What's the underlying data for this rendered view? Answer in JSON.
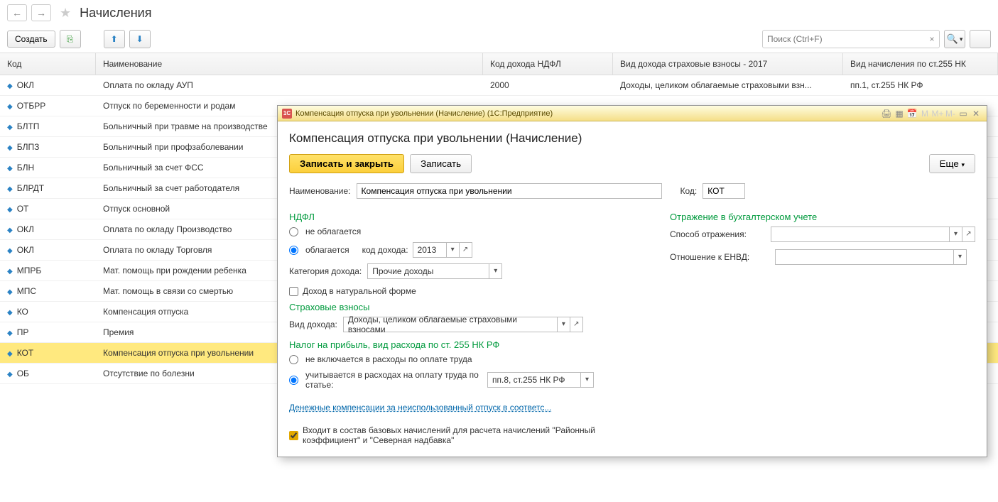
{
  "page": {
    "title": "Начисления",
    "create_btn": "Создать",
    "search_placeholder": "Поиск (Ctrl+F)"
  },
  "table": {
    "headers": {
      "code": "Код",
      "name": "Наименование",
      "ndfl": "Код дохода НДФЛ",
      "ins": "Вид дохода страховые взносы - 2017",
      "c255": "Вид начисления по ст.255 НК"
    },
    "rows": [
      {
        "code": "ОКЛ",
        "name": "Оплата по окладу АУП",
        "ndfl": "2000",
        "ins": "Доходы, целиком облагаемые страховыми взн...",
        "c255": "пп.1, ст.255 НК РФ"
      },
      {
        "code": "ОТБРР",
        "name": "Отпуск по беременности и родам",
        "ndfl": "",
        "ins": "",
        "c255": ""
      },
      {
        "code": "БЛТП",
        "name": "Больничный при травме на производстве",
        "ndfl": "",
        "ins": "",
        "c255": ""
      },
      {
        "code": "БЛПЗ",
        "name": "Больничный при профзаболевании",
        "ndfl": "",
        "ins": "",
        "c255": ""
      },
      {
        "code": "БЛН",
        "name": "Больничный за счет ФСС",
        "ndfl": "",
        "ins": "",
        "c255": ""
      },
      {
        "code": "БЛРДТ",
        "name": "Больничный за счет работодателя",
        "ndfl": "",
        "ins": "",
        "c255": ""
      },
      {
        "code": "ОТ",
        "name": "Отпуск основной",
        "ndfl": "",
        "ins": "",
        "c255": ""
      },
      {
        "code": "ОКЛ",
        "name": "Оплата по окладу Производство",
        "ndfl": "",
        "ins": "",
        "c255": ""
      },
      {
        "code": "ОКЛ",
        "name": "Оплата по окладу Торговля",
        "ndfl": "",
        "ins": "",
        "c255": ""
      },
      {
        "code": "МПРБ",
        "name": "Мат. помощь при рождении ребенка",
        "ndfl": "",
        "ins": "",
        "c255": ""
      },
      {
        "code": "МПС",
        "name": "Мат. помощь в связи со смертью",
        "ndfl": "",
        "ins": "",
        "c255": ""
      },
      {
        "code": "КО",
        "name": "Компенсация отпуска",
        "ndfl": "",
        "ins": "",
        "c255": ""
      },
      {
        "code": "ПР",
        "name": "Премия",
        "ndfl": "",
        "ins": "",
        "c255": ""
      },
      {
        "code": "КОТ",
        "name": "Компенсация отпуска при увольнении",
        "ndfl": "",
        "ins": "",
        "c255": "",
        "selected": true
      },
      {
        "code": "ОБ",
        "name": "Отсутствие по болезни",
        "ndfl": "",
        "ins": "",
        "c255": ""
      }
    ]
  },
  "modal": {
    "window_title": "Компенсация отпуска при увольнении (Начисление)  (1С:Предприятие)",
    "header": "Компенсация отпуска при увольнении (Начисление)",
    "save_close": "Записать и закрыть",
    "save": "Записать",
    "more": "Еще",
    "name_label": "Наименование:",
    "name_value": "Компенсация отпуска при увольнении",
    "code_label": "Код:",
    "code_value": "КОТ",
    "ndfl_title": "НДФЛ",
    "ndfl_opt1": "не облагается",
    "ndfl_opt2": "облагается",
    "ndfl_code_income_label": "код дохода:",
    "ndfl_code_income_value": "2013",
    "cat_income_label": "Категория дохода:",
    "cat_income_value": "Прочие доходы",
    "natural_form": "Доход в натуральной форме",
    "ins_title": "Страховые взносы",
    "ins_type_label": "Вид дохода:",
    "ins_type_value": "Доходы, целиком облагаемые страховыми взносами",
    "profit_title": "Налог на прибыль, вид расхода по ст. 255 НК РФ",
    "profit_opt1": "не включается в расходы по оплате труда",
    "profit_opt2": "учитывается в расходах на оплату труда по статье:",
    "profit_value": "пп.8, ст.255 НК РФ",
    "hint": "Денежные компенсации за неиспользованный отпуск в соответс...",
    "final": "Входит в состав базовых начислений для расчета начислений \"Районный коэффициент\" и \"Северная надбавка\"",
    "acc_title": "Отражение в бухгалтерском учете",
    "acc_method_label": "Способ отражения:",
    "acc_envd_label": "Отношение к ЕНВД:"
  }
}
